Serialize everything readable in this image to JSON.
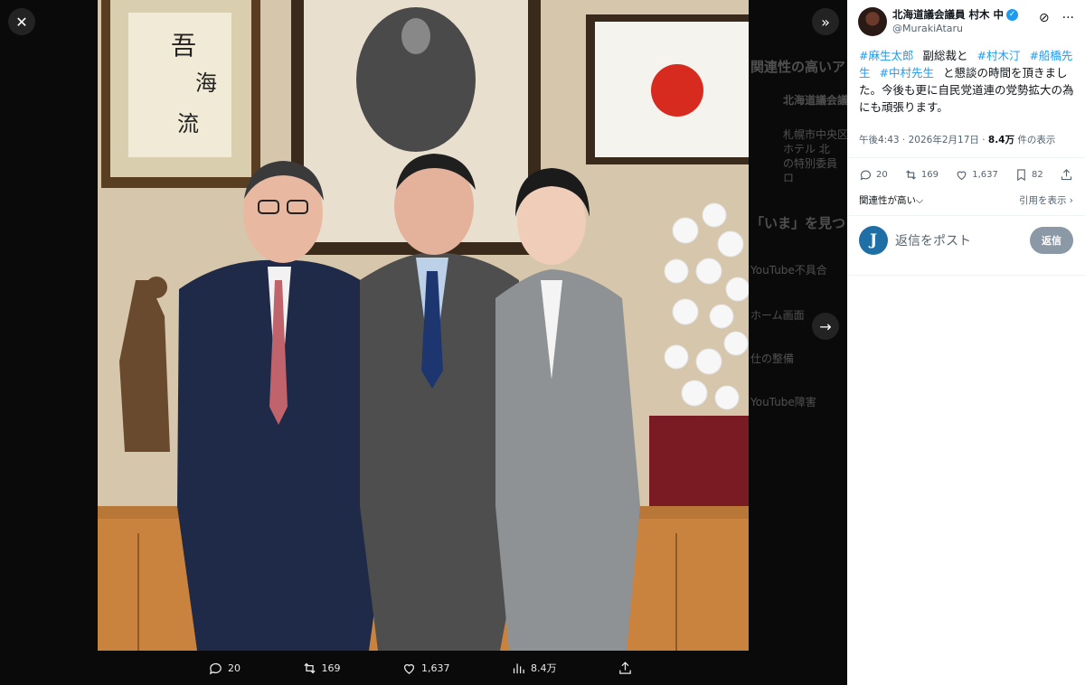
{
  "viewer": {
    "close_icon": "close-icon",
    "collapse_icon": "double-chevron-right-icon",
    "next_icon": "arrow-right-icon",
    "photo_alt": "",
    "actions": {
      "replies": "20",
      "reposts": "169",
      "likes": "1,637",
      "views": "8.4万"
    },
    "background_timeline": {
      "heading1": "関連性の高いア",
      "post_author": "北海道議会議",
      "post_lines": [
        "札幌市中央区",
        "ホテル 北",
        "の特別委員",
        "ロ"
      ],
      "heading2": "「いま」を見つ",
      "trends": [
        "YouTube不具合",
        "ホーム画面",
        "仕の整備",
        "YouTube障害"
      ]
    }
  },
  "tweet": {
    "display_name": "北海道議会議員 村木 中",
    "handle": "@MurakiAtaru",
    "text_parts": [
      {
        "type": "tag",
        "text": "#麻生太郎"
      },
      {
        "type": "text",
        "text": "副総裁と"
      },
      {
        "type": "tag",
        "text": "#村木汀"
      },
      {
        "type": "tag",
        "text": "#船橋先生"
      },
      {
        "type": "tag",
        "text": "#中村先生"
      },
      {
        "type": "text",
        "text": "と懇談の時間を頂きました。今後も更に自民党道連の党勢拡大の為にも頑張ります。"
      }
    ],
    "time": "午後4:43",
    "date": "2026年2月17日",
    "views_count": "8.4万",
    "views_label": "件の表示",
    "stats": {
      "replies": "20",
      "reposts": "169",
      "likes": "1,637",
      "bookmarks": "82"
    },
    "sort_label": "関連性が高い",
    "quotes_label": "引用を表示",
    "reply_avatar_letter": "J",
    "reply_placeholder": "返信をポスト",
    "reply_button": "返信"
  },
  "colors": {
    "accent": "#1d9bf0",
    "reply_button_bg": "#8b98a5"
  }
}
